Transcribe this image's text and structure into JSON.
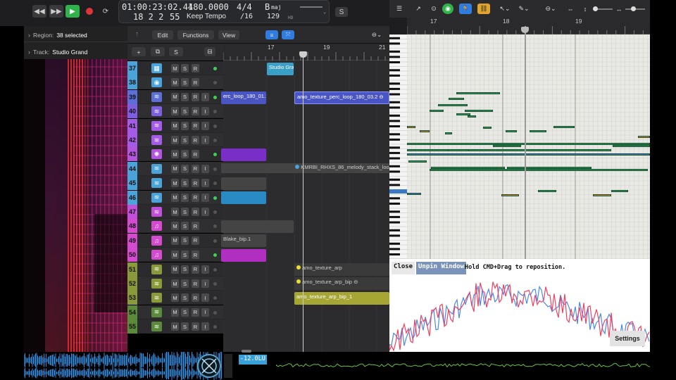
{
  "lcd": {
    "position": "01:00:23:02.44",
    "bars": "18  2  2",
    "ticks": "55",
    "tempo": "180.0000",
    "tempo_mode": "Keep Tempo",
    "signature": "4/4",
    "division": "/16",
    "key_letter": "B",
    "key_mode": "maj",
    "in": "129",
    "hd": "HD"
  },
  "inspector": {
    "region_label": "Region:",
    "region_value": "38 selected",
    "track_label": "Track:",
    "track_value": "Studio Grand"
  },
  "track_header": {
    "edit": "Edit",
    "functions": "Functions",
    "view": "View",
    "s_label": "S"
  },
  "ruler": {
    "m17": "17",
    "m19": "19",
    "m21": "21"
  },
  "tracks": [
    {
      "num": "37",
      "color": "#4aa3d9",
      "icon": "drum-machine-icon",
      "glyph": "▦",
      "rec": false,
      "active": true
    },
    {
      "num": "38",
      "color": "#4aa3d9",
      "icon": "drummer-icon",
      "glyph": "◉",
      "rec": false,
      "active": false
    },
    {
      "num": "39",
      "color": "#5b6fd6",
      "icon": "waveform-icon",
      "glyph": "≋",
      "rec": true,
      "active": true
    },
    {
      "num": "40",
      "color": "#7d5fe0",
      "icon": "waveform-icon",
      "glyph": "≋",
      "rec": true,
      "active": false
    },
    {
      "num": "41",
      "color": "#a45be6",
      "icon": "waveform-icon",
      "glyph": "≋",
      "rec": true,
      "active": false
    },
    {
      "num": "42",
      "color": "#a45be6",
      "icon": "waveform-icon",
      "glyph": "≋",
      "rec": true,
      "active": false
    },
    {
      "num": "43",
      "color": "#b455e0",
      "icon": "synth-icon",
      "glyph": "✺",
      "rec": false,
      "active": true
    },
    {
      "num": "44",
      "color": "#4aa3d9",
      "icon": "waveform-icon",
      "glyph": "≋",
      "rec": true,
      "active": false
    },
    {
      "num": "45",
      "color": "#4aa3d9",
      "icon": "waveform-icon",
      "glyph": "≋",
      "rec": true,
      "active": false
    },
    {
      "num": "46",
      "color": "#4aa3d9",
      "icon": "waveform-icon",
      "glyph": "≋",
      "rec": true,
      "active": true
    },
    {
      "num": "47",
      "color": "#c24fd9",
      "icon": "waveform-icon",
      "glyph": "≋",
      "rec": true,
      "active": false
    },
    {
      "num": "48",
      "color": "#d44bd0",
      "icon": "midi-icon",
      "glyph": "♫",
      "rec": false,
      "active": false
    },
    {
      "num": "49",
      "color": "#d44bd0",
      "icon": "midi-icon",
      "glyph": "♫",
      "rec": false,
      "active": false
    },
    {
      "num": "50",
      "color": "#d44bd0",
      "icon": "midi-icon",
      "glyph": "♫",
      "rec": false,
      "active": true
    },
    {
      "num": "51",
      "color": "#8a9a3a",
      "icon": "waveform-icon",
      "glyph": "≋",
      "rec": true,
      "active": false
    },
    {
      "num": "52",
      "color": "#8a9a3a",
      "icon": "waveform-icon",
      "glyph": "≋",
      "rec": true,
      "active": false
    },
    {
      "num": "53",
      "color": "#8a9a3a",
      "icon": "waveform-icon",
      "glyph": "≋",
      "rec": true,
      "active": false
    },
    {
      "num": "54",
      "color": "#5a8a3a",
      "icon": "waveform-icon",
      "glyph": "≋",
      "rec": true,
      "active": false
    },
    {
      "num": "55",
      "color": "#5a8a3a",
      "icon": "waveform-icon",
      "glyph": "≋",
      "rec": true,
      "active": false
    }
  ],
  "regions": {
    "r37": "Studio Gra",
    "r39a": "erc_loop_180_01.1",
    "r39b": "amo_texture_perc_loop_180_03.2",
    "r44": "KMRBI_RHXS_86_melody_stack_loop",
    "r49": "Blake_bip.1",
    "r51": "amo_texture_arp",
    "r52": "amo_texture_arp_bip",
    "r53": "amo_texture_arp_bip_1"
  },
  "piano_roll": {
    "m17": "17",
    "m18": "18",
    "m19": "19"
  },
  "analyzer": {
    "close": "Close",
    "unpin": "Unpin Window",
    "hint": "Hold CMD+Drag to reposition.",
    "settings": "Settings"
  },
  "meter": {
    "lu": "-12.0LU"
  },
  "colors": {
    "accent": "#2f7de1",
    "play": "#2fb34a",
    "record": "#e0343b"
  }
}
